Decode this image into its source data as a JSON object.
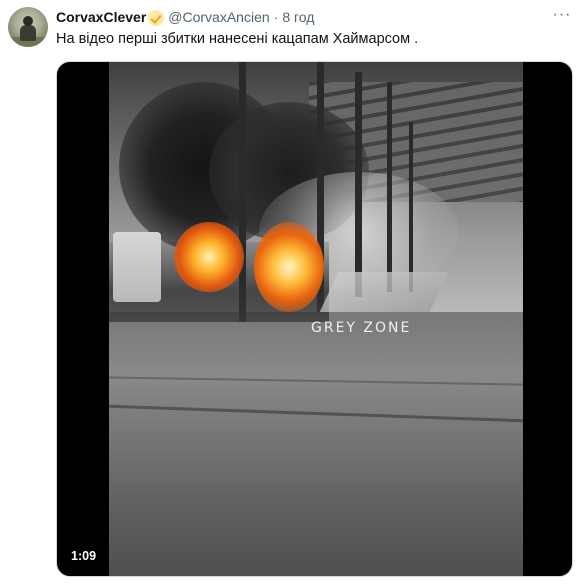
{
  "tweet": {
    "author": {
      "display_name": "CorvaxClever",
      "handle": "@CorvaxAncien",
      "verified_icon": "verified-badge-icon"
    },
    "separator": "·",
    "time": "8 год",
    "text": "На відео перші збитки нанесені кацапам Хаймарсом .",
    "more_icon": "more-dots-icon",
    "more_label": "···"
  },
  "media": {
    "type": "video",
    "watermark": "GREY ZONE",
    "duration": "1:09"
  },
  "colors": {
    "text_primary": "#0f1419",
    "text_secondary": "#536471",
    "badge": "#e8a415",
    "media_bg": "#000000"
  }
}
